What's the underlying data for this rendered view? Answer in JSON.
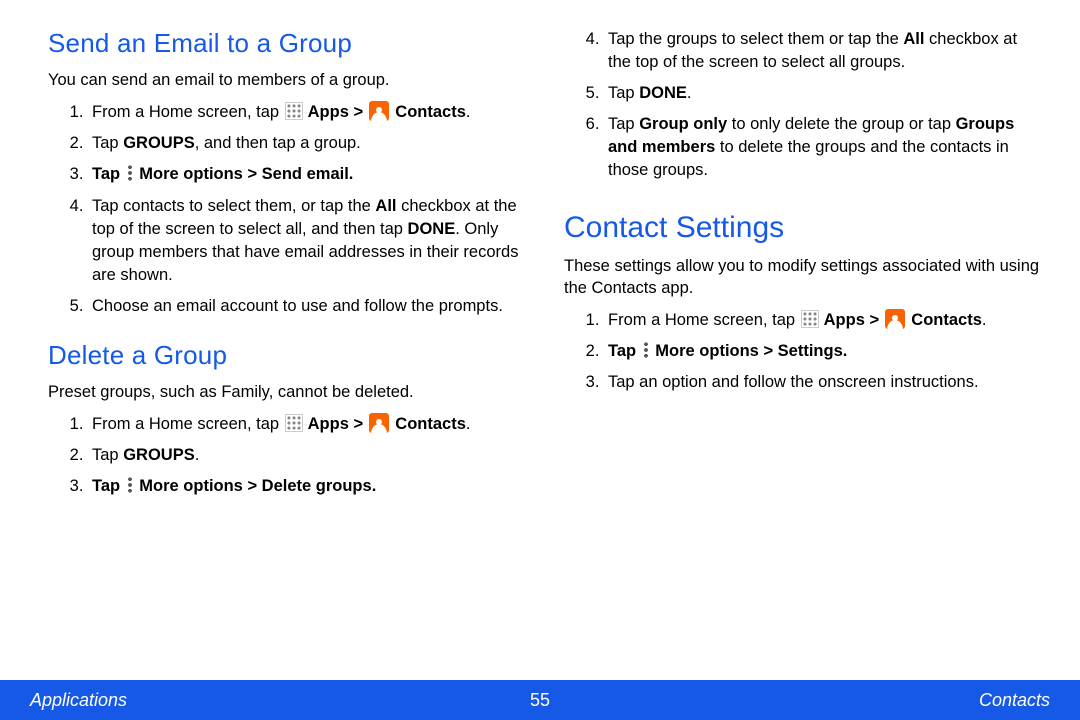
{
  "left_col": {
    "section1": {
      "title": "Send an Email to a Group",
      "intro": "You can send an email to members of a group.",
      "steps": {
        "s1a": "From a Home screen, tap ",
        "s1b": " Apps > ",
        "s1c": " Contacts",
        "s2a": "Tap ",
        "s2b": "GROUPS",
        "s2c": ", and then tap a group.",
        "s3a": "Tap ",
        "s3b": " More options > Send email",
        "s4a": "Tap contacts to select them, or tap the ",
        "s4b": "All",
        "s4c": " checkbox at the top of the screen to select all, and then tap ",
        "s4d": "DONE",
        "s4e": ". Only group members that have email addresses in their records are shown.",
        "s5": "Choose an email account to use and follow the prompts."
      }
    },
    "section2": {
      "title": "Delete a Group",
      "intro": "Preset groups, such as Family, cannot be deleted.",
      "steps": {
        "s1a": "From a Home screen, tap ",
        "s1b": " Apps > ",
        "s1c": " Contacts",
        "s2a": "Tap ",
        "s2b": "GROUPS",
        "s3a": "Tap ",
        "s3b": " More options > Delete groups"
      }
    }
  },
  "right_col": {
    "cont_steps": {
      "s4a": "Tap the groups to select them or tap the ",
      "s4b": "All",
      "s4c": " checkbox at the top of the screen to select all groups.",
      "s5a": "Tap ",
      "s5b": "DONE",
      "s6a": "Tap ",
      "s6b": "Group only",
      "s6c": " to only delete the group or tap ",
      "s6d": "Groups and members",
      "s6e": " to delete the groups and the contacts in those groups."
    },
    "section3": {
      "title": "Contact Settings",
      "intro": "These settings allow you to modify settings associated with using the Contacts app.",
      "steps": {
        "s1a": "From a Home screen, tap ",
        "s1b": " Apps > ",
        "s1c": " Contacts",
        "s2a": "Tap ",
        "s2b": " More options > Settings",
        "s3": "Tap an option and follow the onscreen instructions."
      }
    }
  },
  "footer": {
    "left": "Applications",
    "center": "55",
    "right": "Contacts"
  }
}
